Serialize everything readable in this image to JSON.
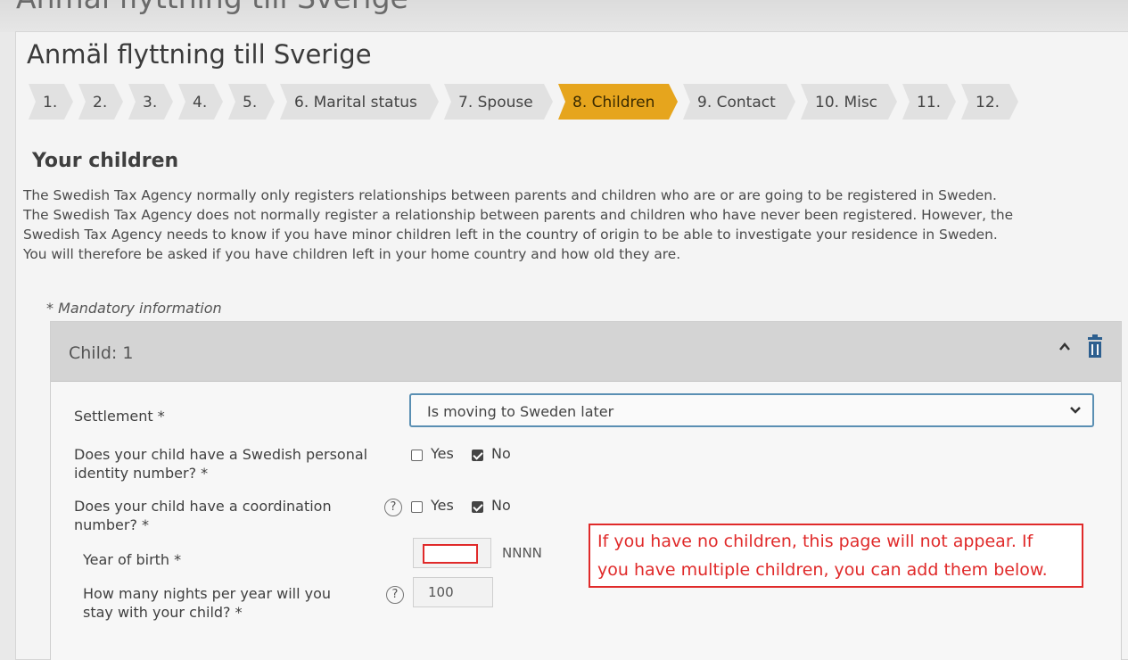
{
  "title": "Anmäl flyttning till Sverige",
  "steps": [
    {
      "label": "1.",
      "active": false
    },
    {
      "label": "2.",
      "active": false
    },
    {
      "label": "3.",
      "active": false
    },
    {
      "label": "4.",
      "active": false
    },
    {
      "label": "5.",
      "active": false
    },
    {
      "label": "6. Marital status",
      "active": false
    },
    {
      "label": "7. Spouse",
      "active": false
    },
    {
      "label": "8. Children",
      "active": true
    },
    {
      "label": "9. Contact",
      "active": false
    },
    {
      "label": "10. Misc",
      "active": false
    },
    {
      "label": "11.",
      "active": false
    },
    {
      "label": "12.",
      "active": false
    }
  ],
  "section": {
    "title": "Your children",
    "intro": [
      "The Swedish Tax Agency normally only registers relationships between parents and children who are or are going to be registered in Sweden.",
      "The Swedish Tax Agency does not normally register a relationship between parents and children who have never been registered. However, the",
      "Swedish Tax Agency needs to know if you have minor children left in the country of origin to be able to investigate your residence in Sweden.",
      "You will therefore be asked if you have children left in your home country and how old they are."
    ],
    "mandatory": "* Mandatory information"
  },
  "child": {
    "title": "Child: 1",
    "settlement": {
      "label": "Settlement *",
      "value": "Is moving to Sweden later"
    },
    "personal_id": {
      "label_line1": "Does your child have a Swedish personal",
      "label_line2": "identity number? *",
      "yes": "Yes",
      "no": "No",
      "selected": "No"
    },
    "coordination": {
      "label_line1": "Does your child have a coordination",
      "label_line2": "number? *",
      "help": "?",
      "yes": "Yes",
      "no": "No",
      "selected": "No"
    },
    "year_of_birth": {
      "label": "Year of birth *",
      "value": "",
      "hint": "NNNN"
    },
    "nights": {
      "label_line1": "How many nights per year will you",
      "label_line2": "stay with your child? *",
      "help": "?",
      "placeholder": "100"
    }
  },
  "annotation": {
    "line1": "If you have no children, this page will not appear. If",
    "line2": "you have multiple children, you can add them below."
  },
  "colors": {
    "active_step": "#e6a51d",
    "annotation_red": "#e02a2a",
    "select_border": "#5a8fb3"
  },
  "icons": [
    "collapse-chevron-up-icon",
    "trash-icon",
    "chevron-down-icon",
    "help-icon"
  ]
}
